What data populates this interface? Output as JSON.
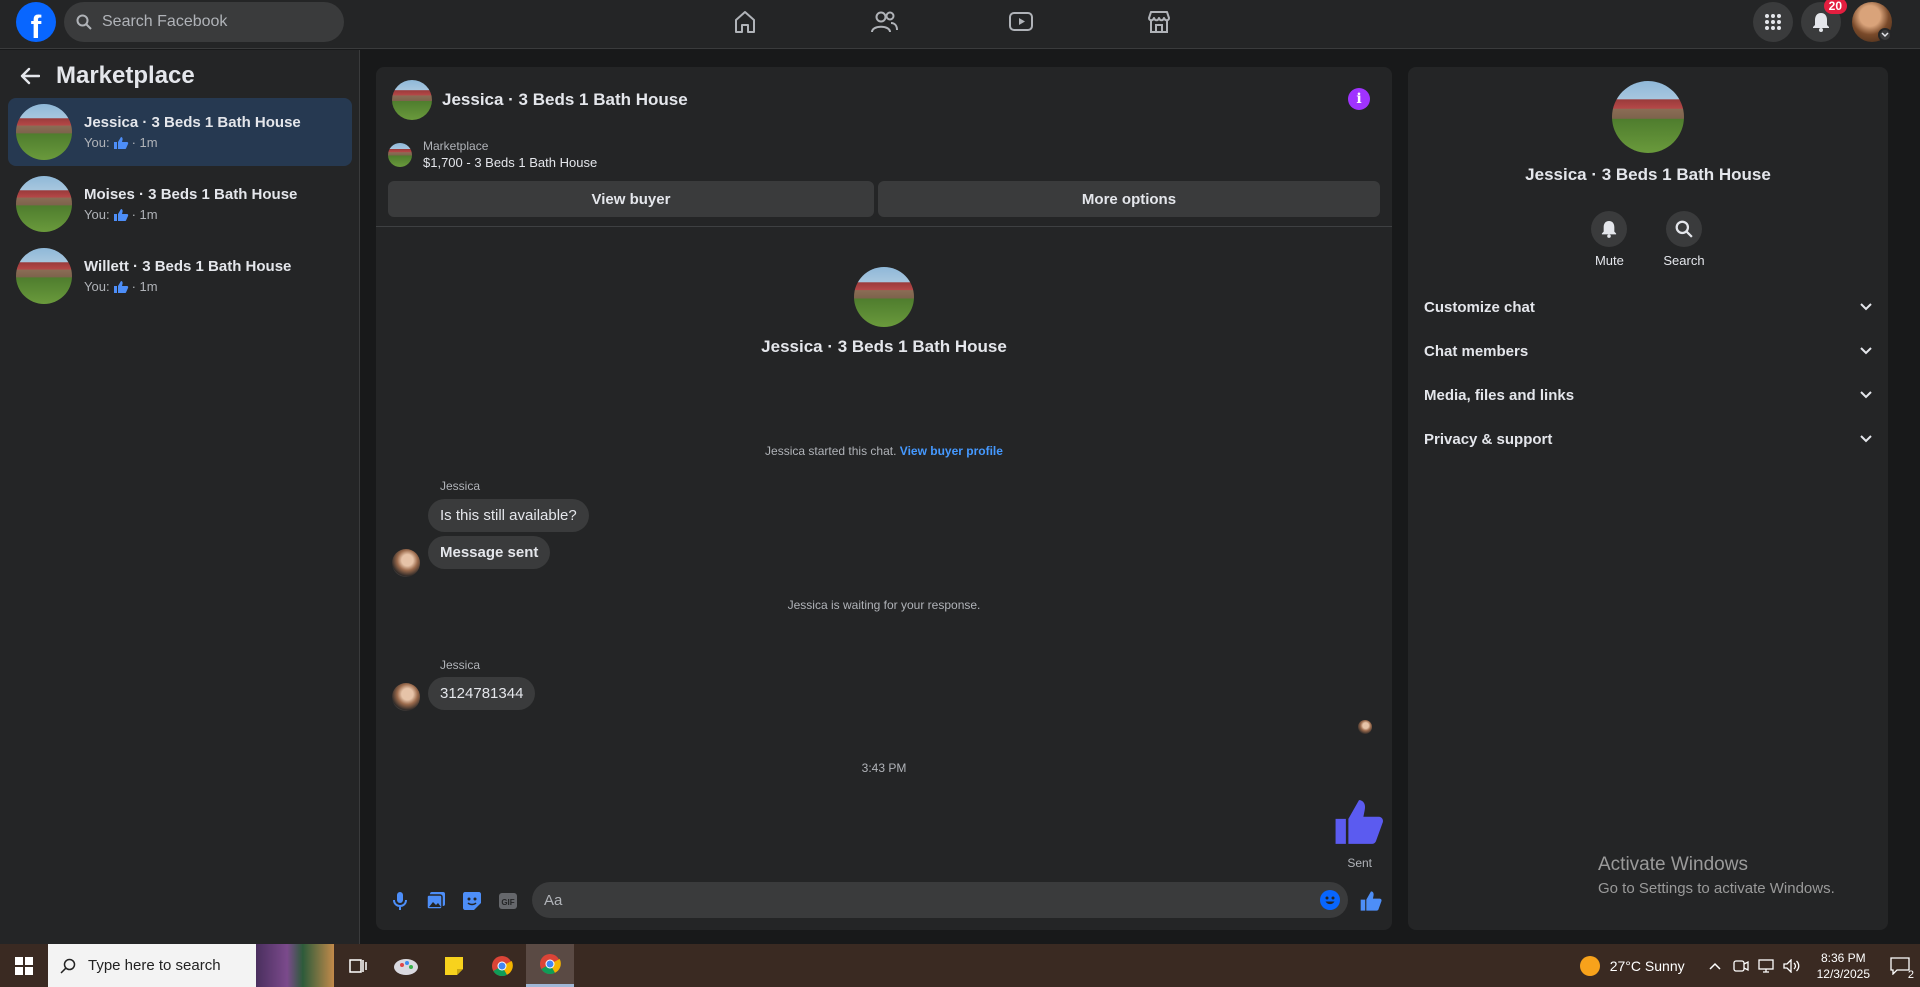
{
  "header": {
    "logo": "f",
    "search_placeholder": "Search Facebook",
    "notifications_count": "20",
    "nav_icons": [
      "home-icon",
      "friends-icon",
      "watch-icon",
      "marketplace-icon"
    ]
  },
  "sidebar": {
    "title": "Marketplace",
    "conversations": [
      {
        "name": "Jessica · 3 Beds 1 Bath House",
        "prefix": "You:",
        "time": "· 1m"
      },
      {
        "name": "Moises · 3 Beds 1 Bath House",
        "prefix": "You:",
        "time": "· 1m"
      },
      {
        "name": "Willett · 3 Beds 1 Bath House",
        "prefix": "You:",
        "time": "· 1m"
      }
    ]
  },
  "chat": {
    "title": "Jessica · 3 Beds 1 Bath House",
    "listing_label": "Marketplace",
    "listing_price": "$1,700 - 3 Beds 1 Bath House",
    "view_buyer": "View buyer",
    "more_options": "More options",
    "intro_name": "Jessica · 3 Beds 1 Bath House",
    "started_text": "Jessica started this chat.",
    "view_profile": "View buyer profile",
    "sender1": "Jessica",
    "msg1": "Is this still available?",
    "msg2": "Message sent",
    "waiting": "Jessica is waiting for your response.",
    "sender2": "Jessica",
    "msg3": "3124781344",
    "time": "3:43 PM",
    "sent": "Sent",
    "composer_placeholder": "Aa"
  },
  "panel": {
    "name": "Jessica · 3 Beds 1 Bath House",
    "mute": "Mute",
    "search": "Search",
    "sections": [
      "Customize chat",
      "Chat members",
      "Media, files and links",
      "Privacy & support"
    ],
    "watermark_title": "Activate Windows",
    "watermark_sub": "Go to Settings to activate Windows."
  },
  "taskbar": {
    "search_text": "Type here to search",
    "weather": "27°C  Sunny",
    "time": "8:36 PM",
    "date": "12/3/2025",
    "notif_count": "2"
  },
  "colors": {
    "accent": "#0866ff",
    "link": "#4599ff",
    "info": "#a033ff",
    "like": "#5b5bf0",
    "badge": "#e41e3f"
  }
}
